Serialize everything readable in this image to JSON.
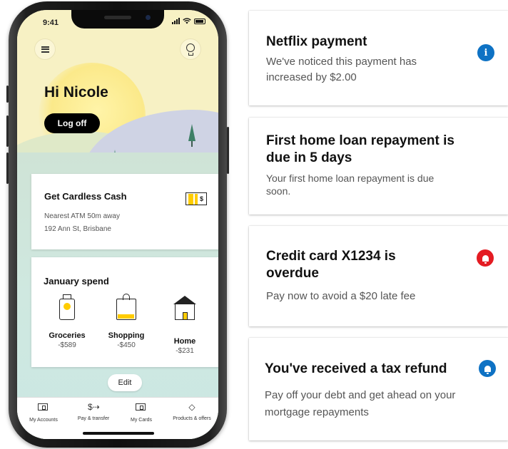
{
  "phone": {
    "status": {
      "time": "9:41"
    },
    "greeting": "Hi Nicole",
    "logoff_label": "Log off",
    "cardless_cash": {
      "title": "Get Cardless Cash",
      "atm_distance": "Nearest ATM 50m away",
      "address": "192 Ann St, Brisbane",
      "icon": "cash-note-icon"
    },
    "january_spend": {
      "title": "January spend",
      "categories": [
        {
          "label": "Groceries",
          "amount": "-$589",
          "icon": "grocery-icon"
        },
        {
          "label": "Shopping",
          "amount": "-$450",
          "icon": "shopping-bag-icon"
        },
        {
          "label": "Home",
          "amount": "-$231",
          "icon": "house-icon"
        }
      ]
    },
    "edit_label": "Edit",
    "tabs": [
      {
        "label": "My Accounts",
        "icon": "wallet-icon"
      },
      {
        "label": "Pay & transfer",
        "icon": "transfer-icon"
      },
      {
        "label": "My Cards",
        "icon": "cards-icon"
      },
      {
        "label": "Products & offers",
        "icon": "tag-icon"
      }
    ],
    "colors": {
      "accent": "#ffcc00",
      "sky": "#f7f1c4"
    }
  },
  "notifications": [
    {
      "title": "Netflix payment",
      "body": "We've noticed this payment has increased by $2.00",
      "badge": "info-icon",
      "badge_text": "i",
      "color": "#0e72c4"
    },
    {
      "title": "First home loan repayment is due in 5 days",
      "body": "Your first home loan repayment is due soon.",
      "badge": "",
      "color": ""
    },
    {
      "title": "Credit card X1234 is overdue",
      "body": "Pay now to avoid a $20 late fee",
      "badge": "bell-icon",
      "color": "#e41b22"
    },
    {
      "title": "You've received a tax refund",
      "body": "Pay off your debt and get ahead on your mortgage repayments",
      "badge": "bell-icon",
      "color": "#0e72c4"
    }
  ]
}
